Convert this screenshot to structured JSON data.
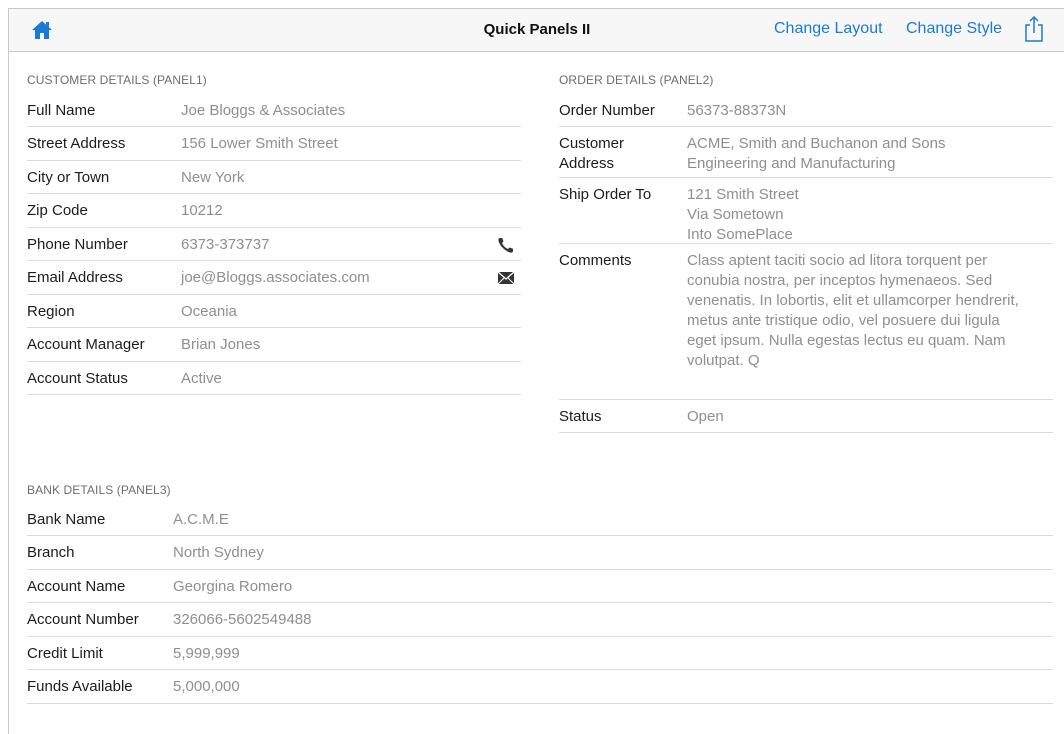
{
  "nav": {
    "title": "Quick Panels II",
    "change_layout": "Change Layout",
    "change_style": "Change Style",
    "home_icon": "home-icon",
    "share_icon": "share-icon",
    "accent": "#1a7bd6"
  },
  "panel1": {
    "header": "CUSTOMER DETAILS (PANEL1)",
    "rows": [
      {
        "label": "Full Name",
        "value": "Joe Bloggs & Associates"
      },
      {
        "label": "Street Address",
        "value": "156 Lower Smith Street"
      },
      {
        "label": "City or Town",
        "value": "New York"
      },
      {
        "label": "Zip Code",
        "value": "10212"
      },
      {
        "label": "Phone Number",
        "value": "6373-373737",
        "icon": "phone-icon"
      },
      {
        "label": "Email Address",
        "value": "joe@Bloggs.associates.com",
        "icon": "mail-icon"
      },
      {
        "label": "Region",
        "value": "Oceania"
      },
      {
        "label": "Account Manager",
        "value": "Brian Jones"
      },
      {
        "label": "Account Status",
        "value": "Active"
      }
    ]
  },
  "panel2": {
    "header": "ORDER DETAILS (PANEL2)",
    "rows": [
      {
        "label": "Order Number",
        "value": "56373-88373N"
      },
      {
        "label": "Customer Address",
        "value": "ACME, Smith and Buchanon and Sons Engineering and Manufacturing"
      },
      {
        "label": "Ship Order To",
        "value": "121 Smith Street\nVia Sometown\nInto SomePlace"
      },
      {
        "label": "Comments",
        "value": "Class aptent taciti socio ad litora torquent per conubia nostra, per inceptos hymenaeos. Sed venenatis. In lobortis, elit et ullamcorper hendrerit, metus ante tristique odio, vel posuere dui ligula eget ipsum. Nulla egestas lectus eu quam. Nam volutpat. Q"
      },
      {
        "label": "Status",
        "value": "Open"
      }
    ]
  },
  "panel3": {
    "header": "BANK DETAILS (PANEL3)",
    "rows": [
      {
        "label": "Bank Name",
        "value": "A.C.M.E"
      },
      {
        "label": "Branch",
        "value": "North Sydney"
      },
      {
        "label": "Account Name",
        "value": "Georgina Romero"
      },
      {
        "label": "Account Number",
        "value": "326066-5602549488"
      },
      {
        "label": "Credit Limit",
        "value": "5,999,999"
      },
      {
        "label": "Funds Available",
        "value": "5,000,000"
      }
    ]
  }
}
